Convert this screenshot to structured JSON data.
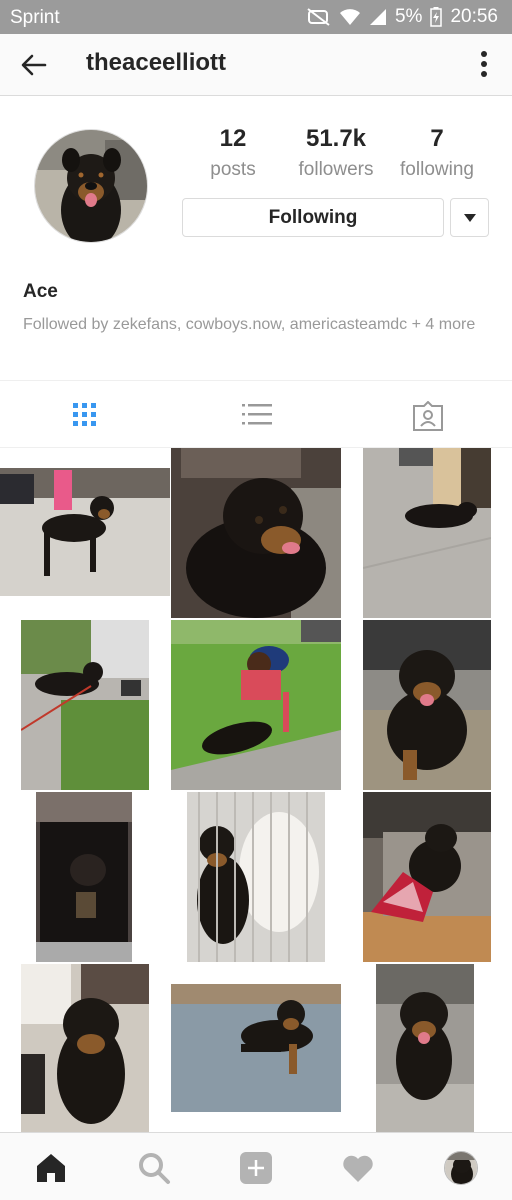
{
  "status_bar": {
    "carrier": "Sprint",
    "battery": "5%",
    "time": "20:56",
    "icons": [
      "mute-icon",
      "wifi-icon",
      "signal-icon",
      "battery-charging-icon"
    ]
  },
  "header": {
    "username": "theaceelliott",
    "icons": [
      "back-arrow-icon",
      "more-vertical-icon"
    ]
  },
  "profile": {
    "stats": {
      "posts": {
        "value": "12",
        "label": "posts"
      },
      "followers": {
        "value": "51.7k",
        "label": "followers"
      },
      "following": {
        "value": "7",
        "label": "following"
      }
    },
    "follow_button_label": "Following",
    "name": "Ace",
    "followed_by": "Followed by zekefans, cowboys.now, americasteamdc + 4 more"
  },
  "tabs": [
    {
      "icon": "grid-icon",
      "active": true
    },
    {
      "icon": "list-icon",
      "active": false
    },
    {
      "icon": "tagged-person-icon",
      "active": false
    }
  ],
  "grid": {
    "photo_count": 12
  },
  "bottom_nav": [
    {
      "icon": "home-icon",
      "active": true
    },
    {
      "icon": "search-icon",
      "active": false
    },
    {
      "icon": "add-post-icon",
      "active": false
    },
    {
      "icon": "heart-icon",
      "active": false
    },
    {
      "icon": "profile-avatar-icon",
      "active": false
    }
  ],
  "colors": {
    "status_bar_bg": "#9b9b9b",
    "accent_blue": "#3897f0",
    "text_primary": "#262626",
    "text_secondary": "#8e8e8e"
  }
}
